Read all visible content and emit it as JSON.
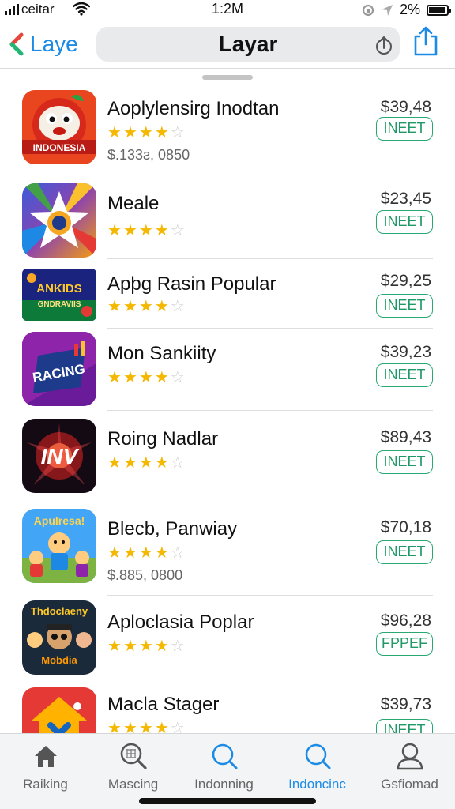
{
  "status_bar": {
    "carrier": "ceitar",
    "time": "1:2M",
    "battery": "2%",
    "battery_level": 0.9
  },
  "nav": {
    "back_label": "Laye",
    "title": "Layar"
  },
  "colors": {
    "accent": "#1b8be6",
    "get_button": "#2aa872",
    "star": "#f5b800"
  },
  "apps": [
    {
      "name": "Aoplylensirg Inodtan",
      "price": "$39,48",
      "button": "INEET",
      "rating": 4,
      "sub": "$.133ƨ, 0850",
      "icon_text": "INDONESIA"
    },
    {
      "name": "Meale",
      "price": "$23,45",
      "button": "INEET",
      "rating": 4,
      "sub": ""
    },
    {
      "name": "Apþg Rasin Popular",
      "price": "$29,25",
      "button": "INEET",
      "rating": 4,
      "sub": "",
      "icon_text": "ANKIDS"
    },
    {
      "name": "Mon Sankiity",
      "price": "$39,23",
      "button": "INEET",
      "rating": 4,
      "sub": "",
      "icon_text": "RACING"
    },
    {
      "name": "Roing Nadlar",
      "price": "$89,43",
      "button": "INEET",
      "rating": 4,
      "sub": "",
      "icon_text": "INV"
    },
    {
      "name": "Blecb, Panwiay",
      "price": "$70,18",
      "button": "INEET",
      "rating": 4,
      "sub": "$.885, 0800",
      "icon_text": "Apulresa!"
    },
    {
      "name": "Aploclasia Poplar",
      "price": "$96,28",
      "button": "FPPEF",
      "rating": 4,
      "sub": "",
      "icon_text": "Mobdia"
    },
    {
      "name": "Macla Stager",
      "price": "$39,73",
      "button": "INEET",
      "rating": 4,
      "sub": ""
    }
  ],
  "tabs": [
    {
      "label": "Raiking",
      "icon": "home-icon",
      "active": false
    },
    {
      "label": "Mascing",
      "icon": "search-grid-icon",
      "active": false
    },
    {
      "label": "Indonning",
      "icon": "search-icon",
      "active": false
    },
    {
      "label": "Indoncinc",
      "icon": "search-icon",
      "active": true
    },
    {
      "label": "Gsfiomad",
      "icon": "profile-icon",
      "active": false
    }
  ]
}
